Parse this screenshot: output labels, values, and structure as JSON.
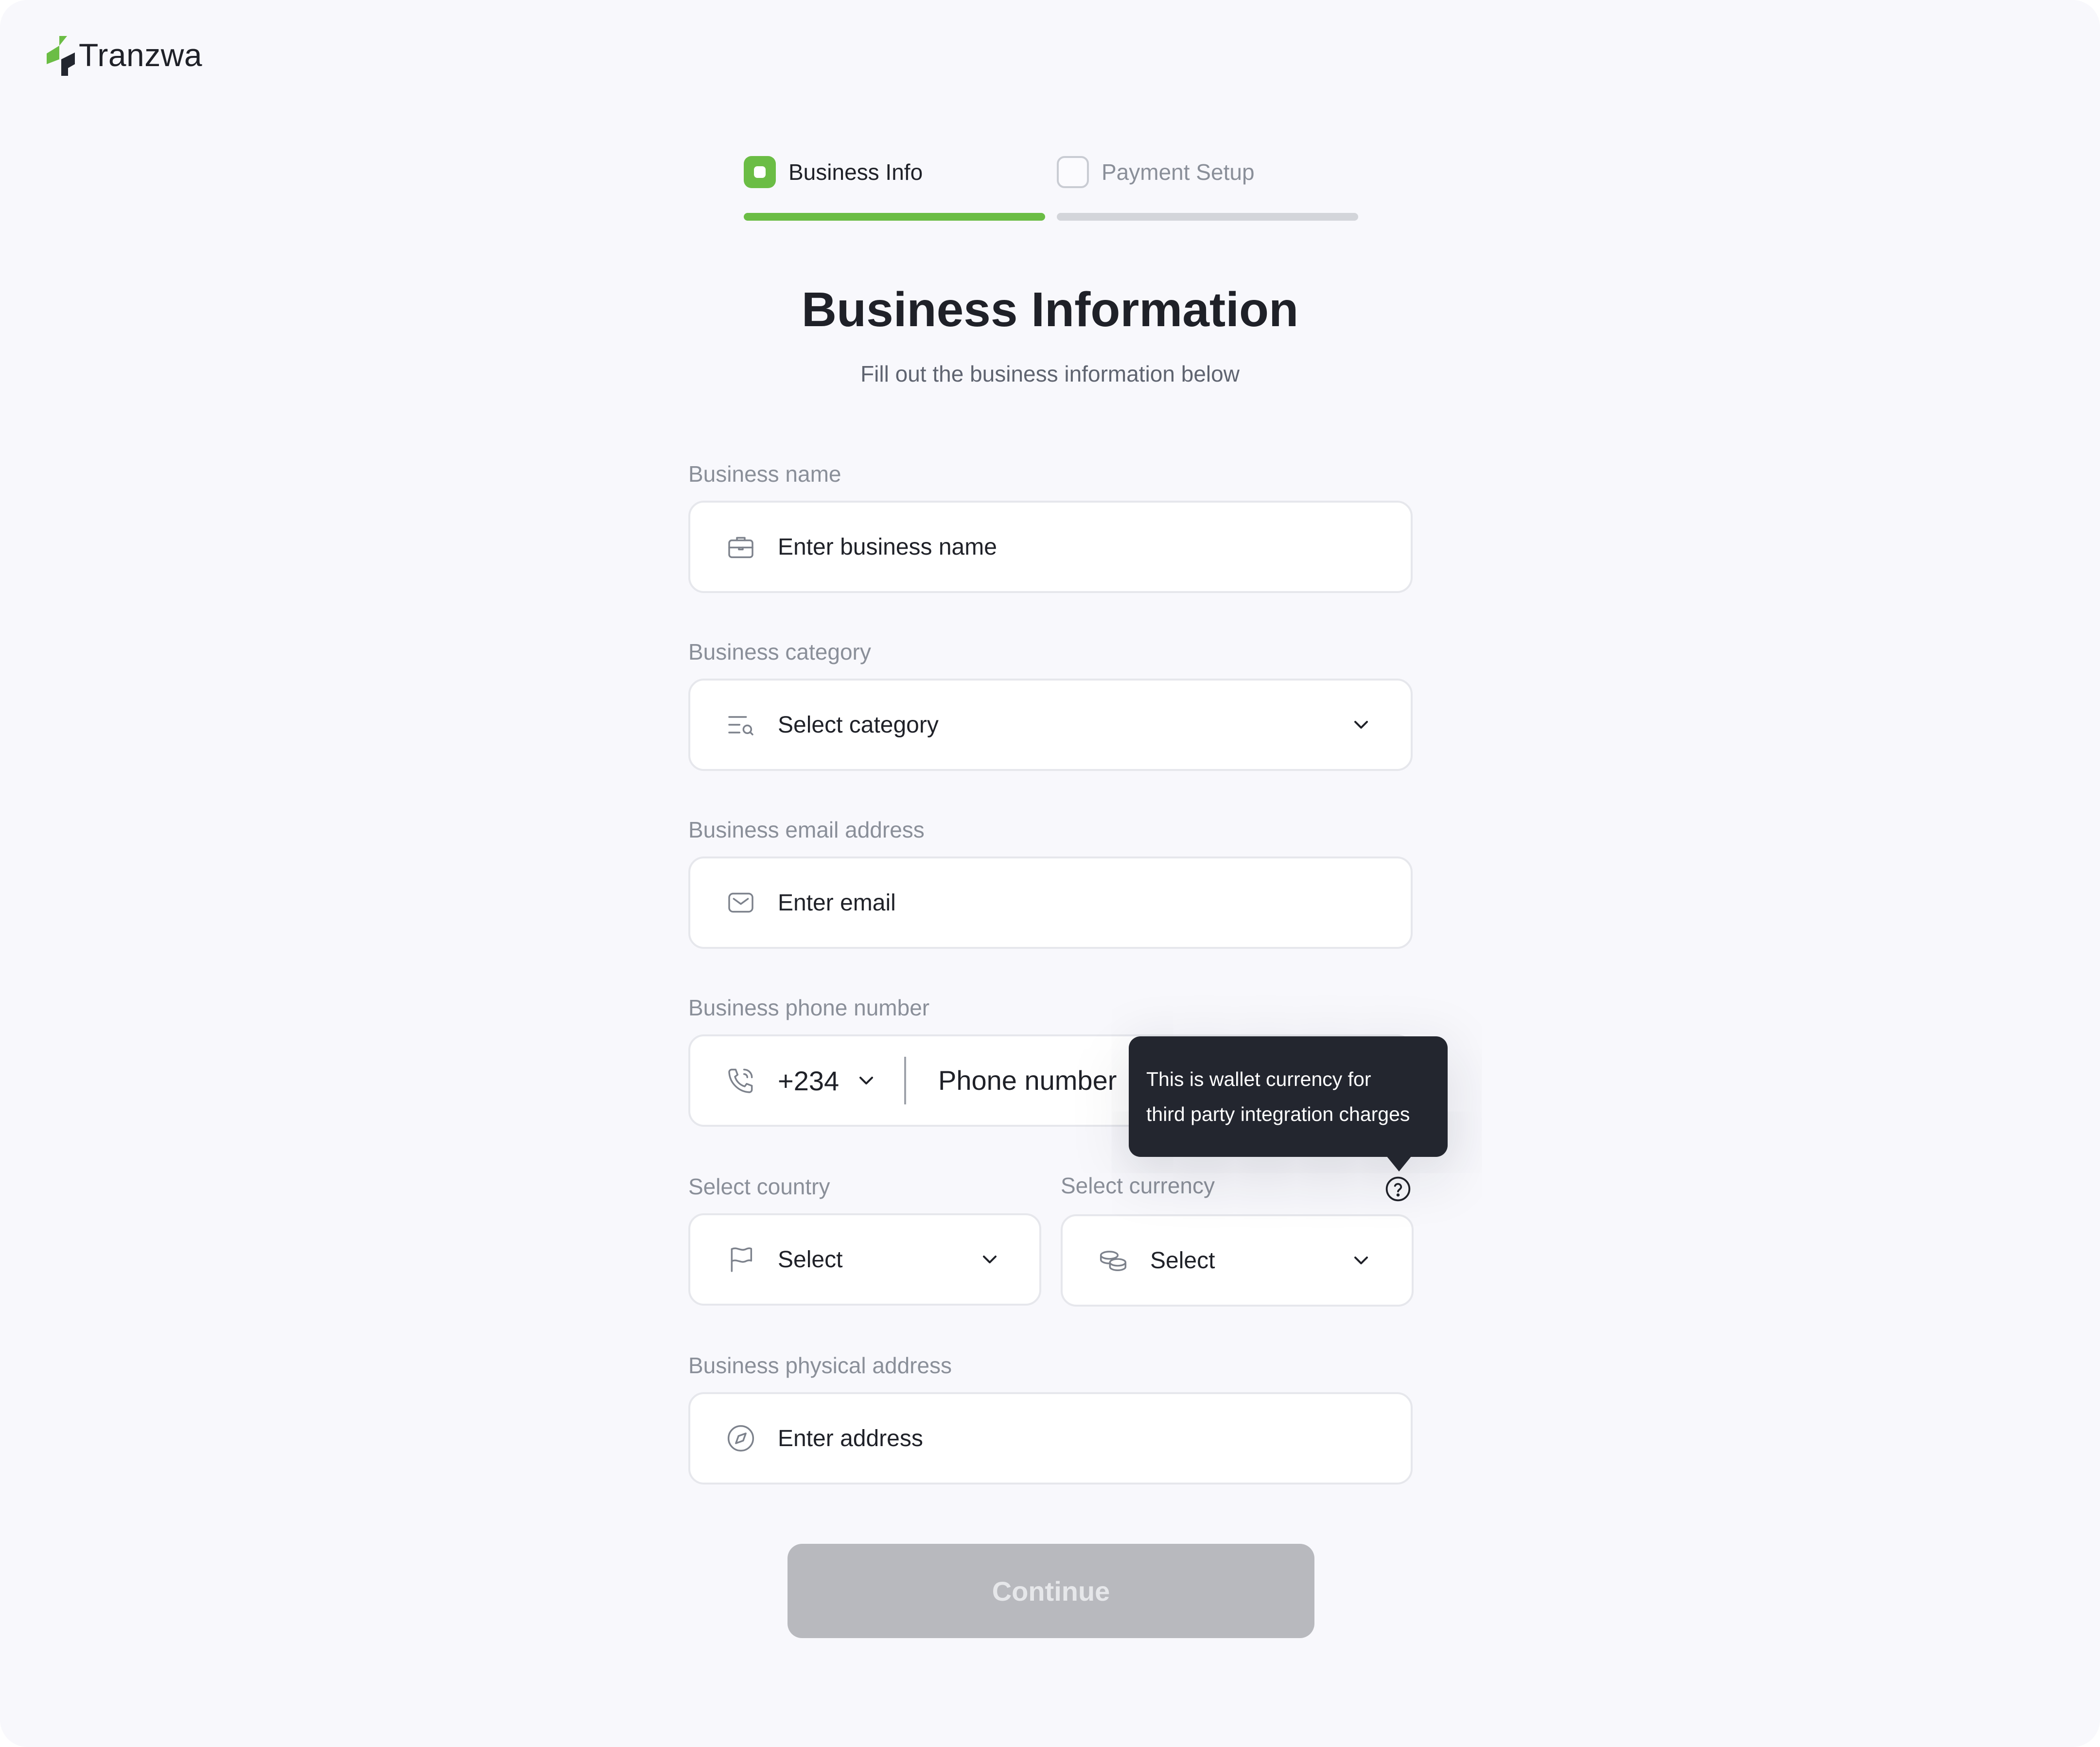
{
  "brand": {
    "name": "Tranzwa"
  },
  "stepper": {
    "steps": [
      {
        "label": "Business Info",
        "state": "active"
      },
      {
        "label": "Payment Setup",
        "state": "inactive"
      }
    ]
  },
  "header": {
    "title": "Business Information",
    "subtitle": "Fill out the business information below"
  },
  "form": {
    "business_name": {
      "label": "Business name",
      "placeholder": "Enter business name",
      "icon": "briefcase-icon"
    },
    "business_category": {
      "label": "Business category",
      "placeholder": "Select category",
      "icon": "list-search-icon"
    },
    "business_email": {
      "label": "Business email address",
      "placeholder": "Enter email",
      "icon": "mail-icon"
    },
    "business_phone": {
      "label": "Business phone number",
      "country_code": "+234",
      "placeholder": "Phone number",
      "icon": "phone-icon"
    },
    "country": {
      "label": "Select country",
      "placeholder": "Select",
      "icon": "flag-icon"
    },
    "currency": {
      "label": "Select currency",
      "placeholder": "Select",
      "icon": "coins-icon"
    },
    "address": {
      "label": "Business physical address",
      "placeholder": "Enter address",
      "icon": "compass-icon"
    }
  },
  "tooltip": {
    "line1": "This is wallet currency for",
    "line2": "third party integration charges"
  },
  "actions": {
    "continue_label": "Continue"
  },
  "colors": {
    "accent": "#6bbd45",
    "text_primary": "#1f2128",
    "text_muted": "#8a8f99",
    "background": "#f8f8fc",
    "button_disabled": "#b8b9be",
    "tooltip_bg": "#23262f"
  }
}
